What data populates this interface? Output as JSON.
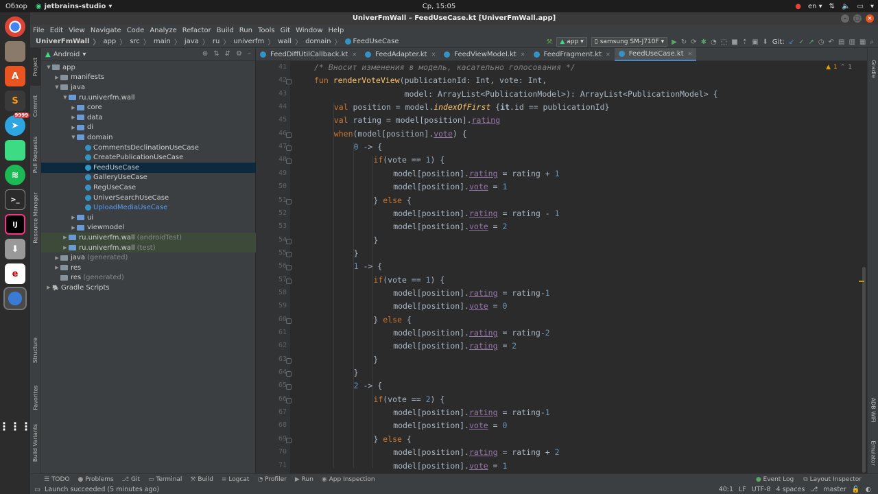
{
  "system": {
    "overview": "Обзор",
    "active_app": "jetbrains-studio",
    "clock": "Ср, 15:05",
    "keyboard": "en"
  },
  "dock": {
    "telegram_badge": "9999",
    "items": [
      "chrome-icon",
      "files-icon",
      "software-center-icon",
      "sublime-icon",
      "telegram-icon",
      "android-icon",
      "spotify-icon",
      "terminal-icon",
      "intellij-icon",
      "installer-icon",
      "pdf-icon",
      "android-studio-icon",
      "apps-grid-icon"
    ]
  },
  "window": {
    "title": "UniverFmWall – FeedUseCase.kt [UniverFmWall.app]"
  },
  "menu": [
    "File",
    "Edit",
    "View",
    "Navigate",
    "Code",
    "Analyze",
    "Refactor",
    "Build",
    "Run",
    "Tools",
    "Git",
    "Window",
    "Help"
  ],
  "breadcrumbs": [
    "UniverFmWall",
    "app",
    "src",
    "main",
    "java",
    "ru",
    "univerfm",
    "wall",
    "domain",
    "FeedUseCase"
  ],
  "toolbar": {
    "run_config": "app",
    "device": "samsung SM-J710F",
    "git_label": "Git:"
  },
  "left_tabs": [
    "Project",
    "Commit",
    "Pull Requests",
    "Resource Manager",
    "Structure",
    "Favorites",
    "Build Variants"
  ],
  "right_tabs": [
    "Gradle",
    "ADB WiFi",
    "Emulator"
  ],
  "project": {
    "header": "Android",
    "tree": [
      {
        "label": "app",
        "depth": 0,
        "kind": "folder",
        "open": true
      },
      {
        "label": "manifests",
        "depth": 1,
        "kind": "folder",
        "open": false
      },
      {
        "label": "java",
        "depth": 1,
        "kind": "folder",
        "open": true
      },
      {
        "label": "ru.univerfm.wall",
        "depth": 2,
        "kind": "folder",
        "open": true
      },
      {
        "label": "core",
        "depth": 3,
        "kind": "folder",
        "open": false
      },
      {
        "label": "data",
        "depth": 3,
        "kind": "folder",
        "open": false
      },
      {
        "label": "di",
        "depth": 3,
        "kind": "folder",
        "open": false
      },
      {
        "label": "domain",
        "depth": 3,
        "kind": "folder",
        "open": true
      },
      {
        "label": "CommentsDeclinationUseCase",
        "depth": 4,
        "kind": "kt"
      },
      {
        "label": "CreatePublicationUseCase",
        "depth": 4,
        "kind": "kt"
      },
      {
        "label": "FeedUseCase",
        "depth": 4,
        "kind": "kt",
        "selected": true
      },
      {
        "label": "GalleryUseCase",
        "depth": 4,
        "kind": "kt"
      },
      {
        "label": "RegUseCase",
        "depth": 4,
        "kind": "kt"
      },
      {
        "label": "UniverSearchUseCase",
        "depth": 4,
        "kind": "kt"
      },
      {
        "label": "UploadMediaUseCase",
        "depth": 4,
        "kind": "kt",
        "blue": true
      },
      {
        "label": "ui",
        "depth": 3,
        "kind": "folder",
        "open": false
      },
      {
        "label": "viewmodel",
        "depth": 3,
        "kind": "folder",
        "open": false
      },
      {
        "label": "ru.univerfm.wall",
        "suffix": "(androidTest)",
        "depth": 2,
        "kind": "folder",
        "open": false,
        "muted": true
      },
      {
        "label": "ru.univerfm.wall",
        "suffix": "(test)",
        "depth": 2,
        "kind": "folder",
        "open": false,
        "muted": true
      },
      {
        "label": "java",
        "suffix": "(generated)",
        "depth": 1,
        "kind": "folder",
        "open": false
      },
      {
        "label": "res",
        "depth": 1,
        "kind": "folder",
        "open": false
      },
      {
        "label": "res",
        "suffix": "(generated)",
        "depth": 1,
        "kind": "folder",
        "open": null
      },
      {
        "label": "Gradle Scripts",
        "depth": 0,
        "kind": "gradle",
        "open": false
      }
    ]
  },
  "editor_tabs": [
    {
      "label": "FeedDiffUtilCallback.kt",
      "active": false
    },
    {
      "label": "FeedAdapter.kt",
      "active": false
    },
    {
      "label": "FeedViewModel.kt",
      "active": false
    },
    {
      "label": "FeedFragment.kt",
      "active": false
    },
    {
      "label": "FeedUseCase.kt",
      "active": true
    }
  ],
  "editor": {
    "warnings": "1",
    "warnings2": "1",
    "lines": [
      {
        "n": "41",
        "html": "<span class='cm'>/* Вносит изменения в модель, касательно голосования */</span>",
        "indent": 1
      },
      {
        "n": "42",
        "html": "<span class='kw'>fun </span><span class='fn'>renderVoteView</span>(publicationId: Int, vote: Int,",
        "indent": 1
      },
      {
        "n": "43",
        "html": "                   model: ArrayList&lt;PublicationModel&gt;): ArrayList&lt;PublicationModel&gt; {",
        "indent": 1
      },
      {
        "n": "44",
        "html": "<span class='kw'>val </span>position = model.<span class='ital'>indexOfFirst</span> {<span class='it'>it</span>.id == publicationId}",
        "indent": 2
      },
      {
        "n": "45",
        "html": "<span class='kw'>val </span>rating = model[position].<span class='prop'>rating</span>",
        "indent": 2
      },
      {
        "n": "46",
        "html": "<span class='kw'>when</span>(model[position].<span class='prop'>vote</span>) {",
        "indent": 2
      },
      {
        "n": "47",
        "html": "<span class='num'>0</span> -&gt; {",
        "indent": 3
      },
      {
        "n": "48",
        "html": "<span class='kw'>if</span>(vote == <span class='num'>1</span>) {",
        "indent": 4
      },
      {
        "n": "49",
        "html": "model[position].<span class='prop'>rating</span> = rating + <span class='num'>1</span>",
        "indent": 5
      },
      {
        "n": "50",
        "html": "model[position].<span class='prop'>vote</span> = <span class='num'>1</span>",
        "indent": 5
      },
      {
        "n": "51",
        "html": "} <span class='kw'>else </span>{",
        "indent": 4
      },
      {
        "n": "52",
        "html": "model[position].<span class='prop'>rating</span> = rating - <span class='num'>1</span>",
        "indent": 5
      },
      {
        "n": "53",
        "html": "model[position].<span class='prop'>vote</span> = <span class='num'>2</span>",
        "indent": 5
      },
      {
        "n": "54",
        "html": "}",
        "indent": 4
      },
      {
        "n": "55",
        "html": "}",
        "indent": 3
      },
      {
        "n": "56",
        "html": "<span class='num'>1</span> -&gt; {",
        "indent": 3
      },
      {
        "n": "57",
        "html": "<span class='kw'>if</span>(vote == <span class='num'>1</span>) {",
        "indent": 4
      },
      {
        "n": "58",
        "html": "model[position].<span class='prop'>rating</span> = rating-<span class='num'>1</span>",
        "indent": 5
      },
      {
        "n": "59",
        "html": "model[position].<span class='prop'>vote</span> = <span class='num'>0</span>",
        "indent": 5
      },
      {
        "n": "60",
        "html": "} <span class='kw'>else </span>{",
        "indent": 4
      },
      {
        "n": "61",
        "html": "model[position].<span class='prop'>rating</span> = rating-<span class='num'>2</span>",
        "indent": 5
      },
      {
        "n": "62",
        "html": "model[position].<span class='prop'>rating</span> = <span class='num'>2</span>",
        "indent": 5
      },
      {
        "n": "63",
        "html": "}",
        "indent": 4
      },
      {
        "n": "64",
        "html": "}",
        "indent": 3
      },
      {
        "n": "65",
        "html": "<span class='num'>2</span> -&gt; {",
        "indent": 3
      },
      {
        "n": "66",
        "html": "<span class='kw'>if</span>(vote == <span class='num'>2</span>) {",
        "indent": 4
      },
      {
        "n": "67",
        "html": "model[position].<span class='prop'>rating</span> = rating-<span class='num'>1</span>",
        "indent": 5
      },
      {
        "n": "68",
        "html": "model[position].<span class='prop'>vote</span> = <span class='num'>0</span>",
        "indent": 5
      },
      {
        "n": "69",
        "html": "} <span class='kw'>else </span>{",
        "indent": 4
      },
      {
        "n": "70",
        "html": "model[position].<span class='prop'>rating</span> = rating + <span class='num'>2</span>",
        "indent": 5
      },
      {
        "n": "71",
        "html": "model[position].<span class='prop'>vote</span> = <span class='num'>1</span>",
        "indent": 5
      }
    ]
  },
  "bottom_tools": [
    "TODO",
    "Problems",
    "Git",
    "Terminal",
    "Build",
    "Logcat",
    "Profiler",
    "Run",
    "App Inspection"
  ],
  "bottom_right_tools": [
    "Event Log",
    "Layout Inspector"
  ],
  "status": {
    "message": "Launch succeeded (5 minutes ago)",
    "position": "40:1",
    "line_sep": "LF",
    "encoding": "UTF-8",
    "indent": "4 spaces",
    "branch": "master"
  }
}
